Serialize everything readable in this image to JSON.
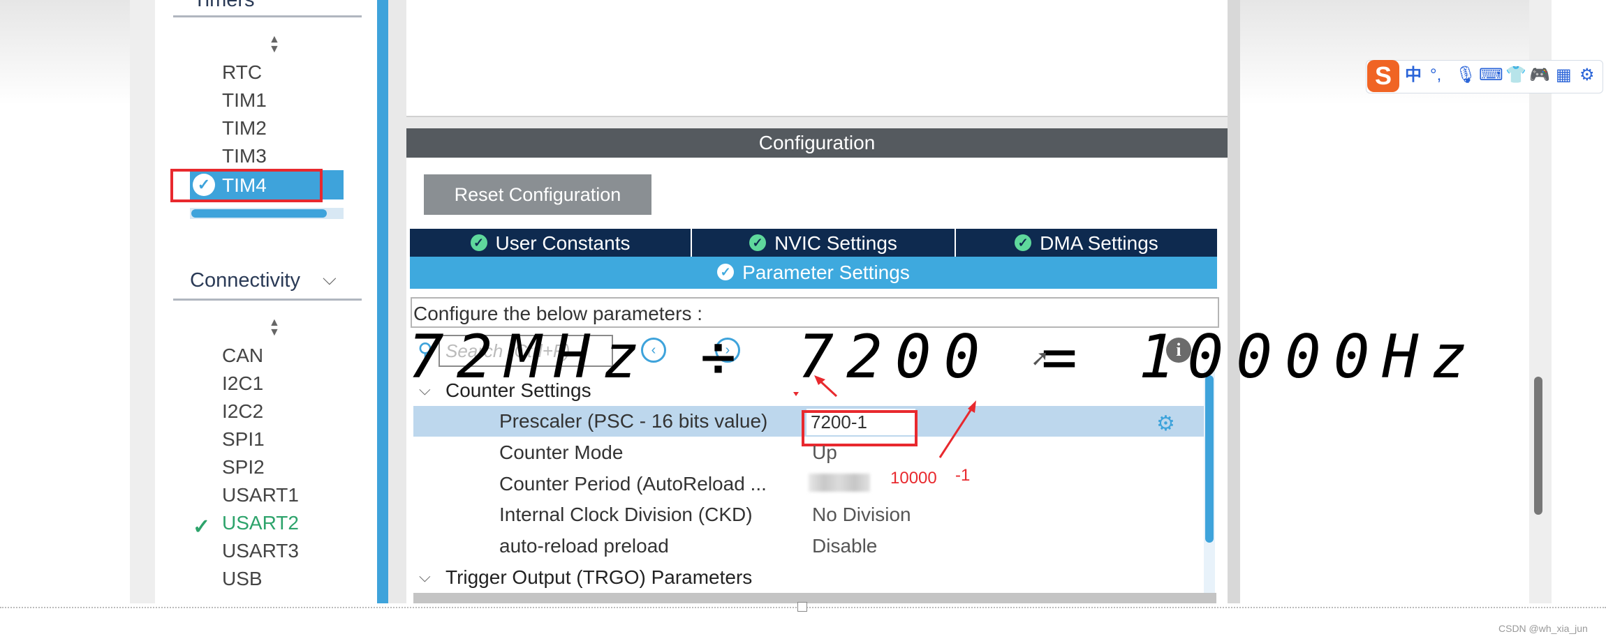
{
  "sidebar": {
    "timers_heading": "Timers",
    "timer_items": [
      "RTC",
      "TIM1",
      "TIM2",
      "TIM3"
    ],
    "selected_timer": "TIM4",
    "connectivity_heading": "Connectivity",
    "connectivity_items": [
      "CAN",
      "I2C1",
      "I2C2",
      "SPI1",
      "SPI2",
      "USART1"
    ],
    "active_connectivity": "USART2",
    "connectivity_items_after": [
      "USART3",
      "USB"
    ]
  },
  "config": {
    "header": "Configuration",
    "reset_button": "Reset Configuration",
    "tabs": [
      "User Constants",
      "NVIC Settings",
      "DMA Settings"
    ],
    "active_tab": "Parameter Settings",
    "configure_text": "Configure the below parameters :",
    "search_placeholder": "Search (Ctrl+F)",
    "sections": {
      "counter": "Counter Settings",
      "trigger": "Trigger Output (TRGO) Parameters"
    },
    "params": [
      {
        "label": "Prescaler (PSC - 16 bits value)",
        "value": "7200-1"
      },
      {
        "label": "Counter Mode",
        "value": "Up"
      },
      {
        "label": "Counter Period (AutoReload ...",
        "value": ""
      },
      {
        "label": "Internal Clock Division (CKD)",
        "value": "No Division"
      },
      {
        "label": "auto-reload preload",
        "value": "Disable"
      }
    ]
  },
  "annotations": {
    "formula": "72MHz ÷ 7200 = 10000Hz",
    "period_note": "10000",
    "minus_one": "-1"
  },
  "ime": {
    "logo": "S",
    "chinese": "中"
  },
  "watermark": "CSDN @wh_xia_jun",
  "colors": {
    "accent_blue": "#3ea3db",
    "dark_navy": "#0e2a4f",
    "annotation_red": "#e8292e",
    "check_green": "#2da36b"
  }
}
